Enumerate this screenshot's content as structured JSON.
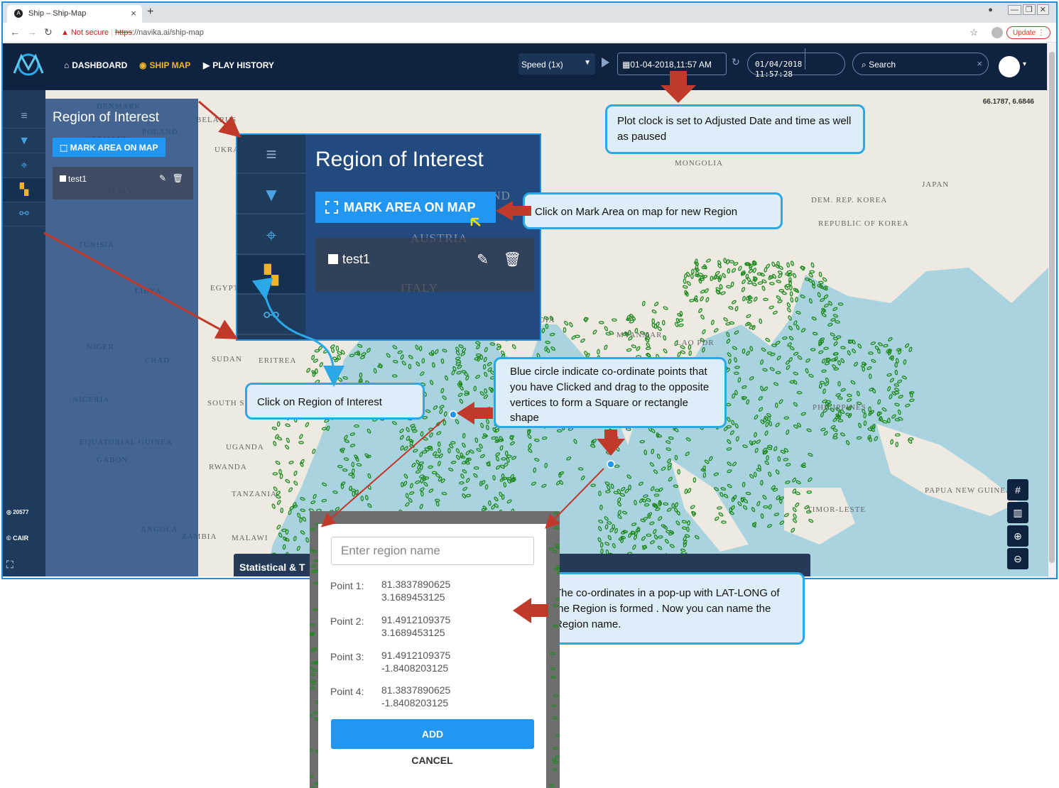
{
  "browser": {
    "tab_title": "Ship – Ship-Map",
    "favicon": "A",
    "new_tab": "+",
    "url_warning": "Not secure",
    "url_scheme": "https",
    "url_host": "://navika.ai/ship-map",
    "update_label": "Update"
  },
  "header": {
    "nav": [
      {
        "label": "DASHBOARD",
        "icon": "home-icon"
      },
      {
        "label": "SHIP MAP",
        "icon": "target-icon",
        "active": true
      },
      {
        "label": "PLAY HISTORY",
        "icon": "play-circle-icon"
      }
    ],
    "speed": "Speed (1x)",
    "datetime": "01-04-2018,11:57 AM",
    "clock_date": "01/04/2018",
    "clock_time": "11:57:28",
    "search_placeholder": "Search"
  },
  "map": {
    "coords": "66.1787, 6.6846",
    "labels": [
      "DENMARK",
      "POLAND",
      "GERMANY",
      "ITALY",
      "BELARUS",
      "UKRA",
      "TUNISIA",
      "LIBYA",
      "EGYPT",
      "NIGER",
      "CHAD",
      "SUDAN",
      "ERITREA",
      "SOUTH SUDAN",
      "NIGERIA",
      "EQUATORIAL GUINEA",
      "GABON",
      "UGANDA",
      "RWANDA",
      "TANZANIA",
      "ANGOLA",
      "ZAMBIA",
      "MALAWI",
      "MONGOLIA",
      "JAPAN",
      "DEM. REP. KOREA",
      "REPUBLIC OF KOREA",
      "MYANMAR",
      "LAO PDR",
      "PHILIPPINES",
      "PAPUA NEW GUINEA",
      "TIMOR-LESTE",
      "DIA"
    ],
    "stat_panel": "Statistical & T",
    "rail_count": "20577",
    "rail_brand": "CAIR"
  },
  "region_panel": {
    "title": "Region of Interest",
    "mark_button": "MARK AREA ON MAP",
    "items": [
      {
        "label": "test1"
      }
    ]
  },
  "callouts": {
    "clock": "Plot clock is set to Adjusted Date and time as well as paused",
    "mark": "Click on Mark Area on map for new Region",
    "roi": "Click on Region of Interest",
    "circle": "Blue circle indicate co-ordinate points that you have Clicked and drag to the opposite vertices to form a Square or rectangle shape",
    "popup": "The co-ordinates in a pop-up with LAT-LONG  of the Region is formed . Now you can name the Region name."
  },
  "popup": {
    "placeholder": "Enter region name",
    "points": [
      {
        "label": "Point 1:",
        "lat": "81.3837890625",
        "lng": "3.1689453125"
      },
      {
        "label": "Point 2:",
        "lat": "91.4912109375",
        "lng": "3.1689453125"
      },
      {
        "label": "Point 3:",
        "lat": "91.4912109375",
        "lng": "-1.8408203125"
      },
      {
        "label": "Point 4:",
        "lat": "81.3837890625",
        "lng": "-1.8408203125"
      }
    ],
    "add": "ADD",
    "cancel": "CANCEL"
  },
  "colors": {
    "header_bg": "#0f2340",
    "accent": "#f0b429",
    "button_blue": "#2196f3",
    "callout_border": "#2aa8e8",
    "arrow_red": "#c0392b",
    "ship_green": "#1e8a1e"
  }
}
